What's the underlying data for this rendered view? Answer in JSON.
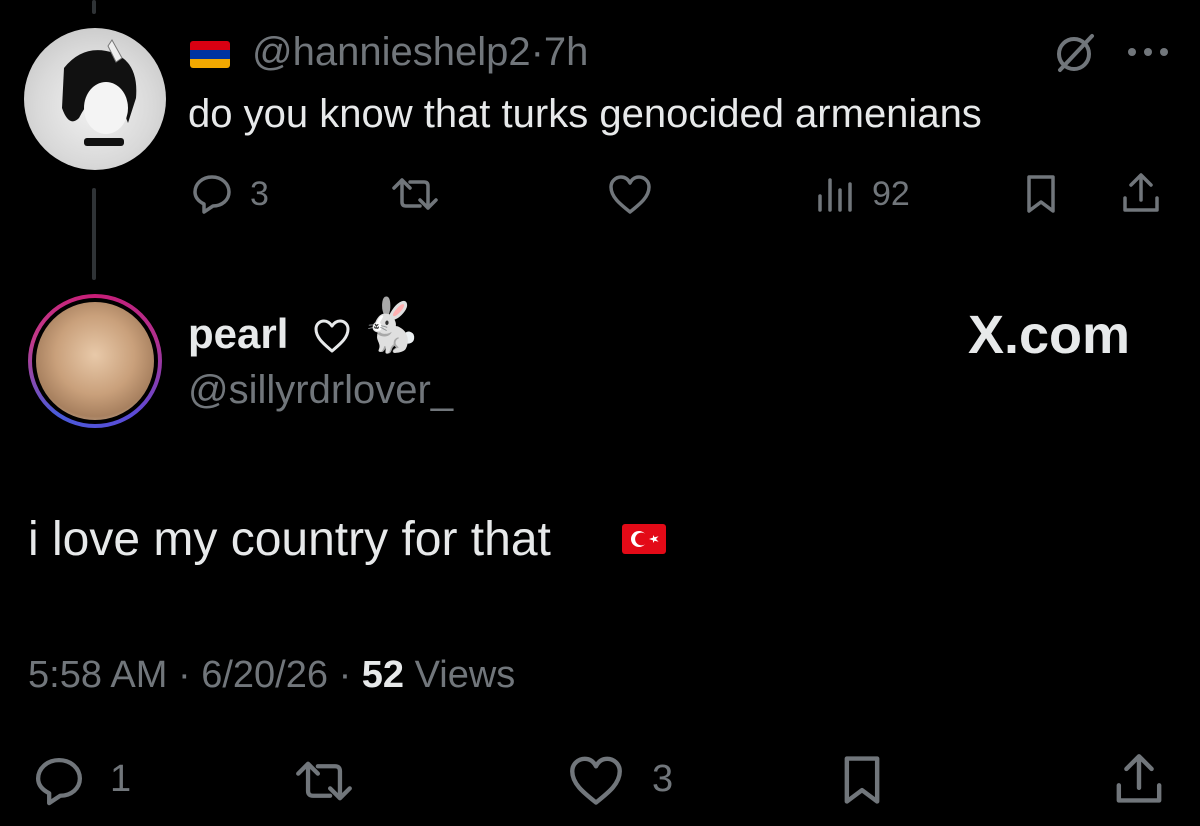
{
  "reply_tweet": {
    "handle": "@hannieshelp2",
    "separator": "·",
    "time": "7h",
    "text": "do you know that turks genocided armenians",
    "flag_colors": [
      "#d90012",
      "#0033a0",
      "#f2a800"
    ],
    "icons": [
      "grok-icon",
      "more-icon"
    ],
    "actions": {
      "replies": "3",
      "retweets": "",
      "likes": "",
      "views": "92"
    }
  },
  "main_tweet": {
    "display_name": "pearl",
    "name_emoji": "🐇",
    "handle": "@sillyrdrlover_",
    "brand": "X.com",
    "text": "i love my country for that",
    "flag_colors": [
      "#e30a17",
      "#ffffff"
    ],
    "meta": {
      "time": "5:58 AM",
      "separator": "·",
      "date": "6/20/26",
      "separator2": "·",
      "views_count": "52",
      "views_label": "Views"
    },
    "actions": {
      "replies": "1",
      "retweets": "",
      "likes": "3"
    }
  },
  "theme": {
    "background": "#000000",
    "text_primary": "#e7e9ea",
    "text_secondary": "#71767b",
    "thread_line": "#2f3336"
  }
}
